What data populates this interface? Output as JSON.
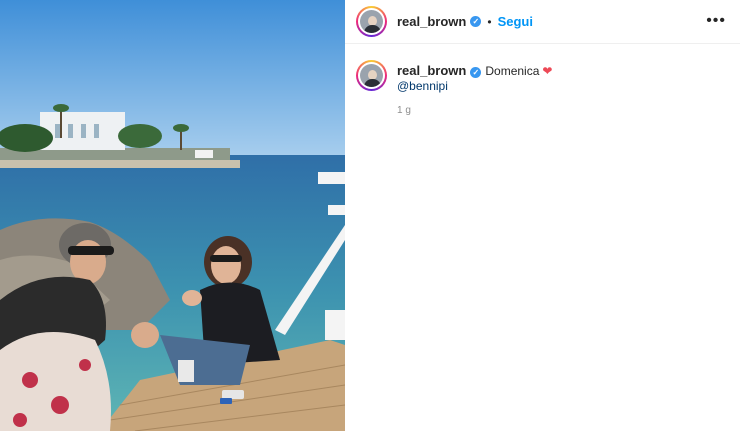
{
  "post": {
    "image_alt": "photo",
    "header": {
      "username": "real_brown",
      "verified_glyph": "✓",
      "separator": "•",
      "follow_label": "Segui",
      "more_icon": "more-icon",
      "more_glyph": "•••"
    },
    "caption": {
      "username": "real_brown",
      "text": "Domenica",
      "emoji": "❤",
      "mention": "@bennipi"
    },
    "timestamp": "1 g"
  }
}
